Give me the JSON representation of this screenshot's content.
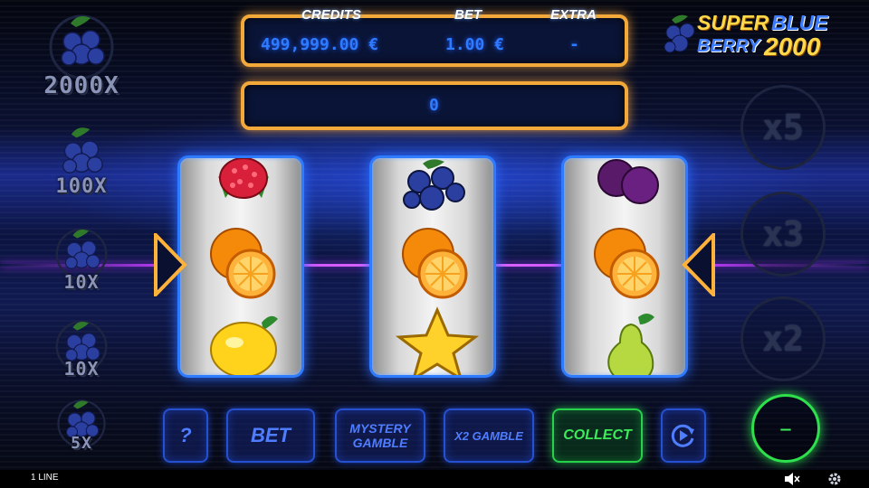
{
  "game": {
    "logo": {
      "super": "SUPER",
      "blue": "BLUE",
      "berry": "BERRY",
      "number": "2000"
    }
  },
  "colors": {
    "accent_orange": "#f3a93a",
    "value_blue": "#2f7bff",
    "reel_border": "#2e7bff",
    "collect_green": "#3dea5a",
    "laser": "#c23cff"
  },
  "paytable": [
    {
      "label": "2000X",
      "icon": "blueberry-icon"
    },
    {
      "label": "100X",
      "icon": "blueberry-icon"
    },
    {
      "label": "10X",
      "icon": "blueberry-icon"
    },
    {
      "label": "10X",
      "icon": "blueberry-icon"
    },
    {
      "label": "5X",
      "icon": "blueberry-icon"
    }
  ],
  "info": {
    "credits_label": "CREDITS",
    "credits_value": "499,999.00 €",
    "bet_label": "BET",
    "bet_value": "1.00 €",
    "extra_label": "EXTRA",
    "extra_value": "-",
    "win_value": "0"
  },
  "reels": [
    {
      "symbols": [
        "raspberry-icon",
        "orange-icon",
        "lemon-icon"
      ]
    },
    {
      "symbols": [
        "blueberry-icon",
        "orange-icon",
        "star-icon"
      ]
    },
    {
      "symbols": [
        "plum-icon",
        "orange-icon",
        "pear-icon"
      ]
    }
  ],
  "multipliers": [
    "x5",
    "x3",
    "x2"
  ],
  "buttons": {
    "help": "?",
    "bet": "BET",
    "mystery_line1": "MYSTERY",
    "mystery_line2": "GAMBLE",
    "x2_gamble": "X2 GAMBLE",
    "collect": "COLLECT",
    "autoplay_icon": "autoplay-icon",
    "spin": "–"
  },
  "footer": {
    "lines": "1 LINE",
    "sound_icon": "mute-icon",
    "settings_icon": "gear-icon"
  }
}
